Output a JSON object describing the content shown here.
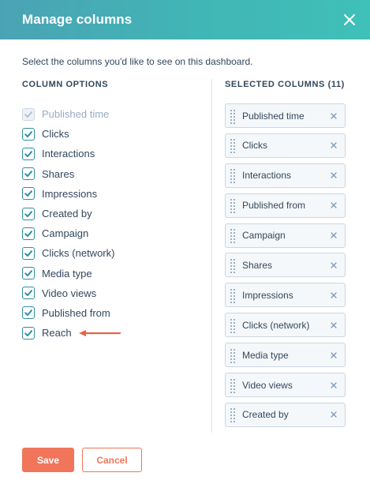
{
  "modal": {
    "title": "Manage columns",
    "close_icon": "close-icon",
    "instructions": "Select the columns you'd like to see on this dashboard."
  },
  "column_options": {
    "heading": "COLUMN OPTIONS",
    "items": [
      {
        "label": "Published time",
        "checked": true,
        "disabled": true
      },
      {
        "label": "Clicks",
        "checked": true,
        "disabled": false
      },
      {
        "label": "Interactions",
        "checked": true,
        "disabled": false
      },
      {
        "label": "Shares",
        "checked": true,
        "disabled": false
      },
      {
        "label": "Impressions",
        "checked": true,
        "disabled": false
      },
      {
        "label": "Created by",
        "checked": true,
        "disabled": false
      },
      {
        "label": "Campaign",
        "checked": true,
        "disabled": false
      },
      {
        "label": "Clicks (network)",
        "checked": true,
        "disabled": false
      },
      {
        "label": "Media type",
        "checked": true,
        "disabled": false
      },
      {
        "label": "Video views",
        "checked": true,
        "disabled": false
      },
      {
        "label": "Published from",
        "checked": true,
        "disabled": false
      },
      {
        "label": "Reach",
        "checked": true,
        "disabled": false,
        "annotation": "arrow-left-icon"
      }
    ]
  },
  "selected_columns": {
    "heading": "SELECTED COLUMNS (11)",
    "items": [
      {
        "label": "Published time"
      },
      {
        "label": "Clicks"
      },
      {
        "label": "Interactions"
      },
      {
        "label": "Published from"
      },
      {
        "label": "Campaign"
      },
      {
        "label": "Shares"
      },
      {
        "label": "Impressions"
      },
      {
        "label": "Clicks (network)"
      },
      {
        "label": "Media type"
      },
      {
        "label": "Video views"
      },
      {
        "label": "Created by"
      }
    ]
  },
  "footer": {
    "save_label": "Save",
    "cancel_label": "Cancel"
  },
  "colors": {
    "header_gradient_start": "#4aa3b4",
    "header_gradient_end": "#3fc0b8",
    "checkbox_accent": "#2e8fa0",
    "primary_button": "#f1755a",
    "annotation_arrow": "#e8634a",
    "text": "#33475b"
  }
}
